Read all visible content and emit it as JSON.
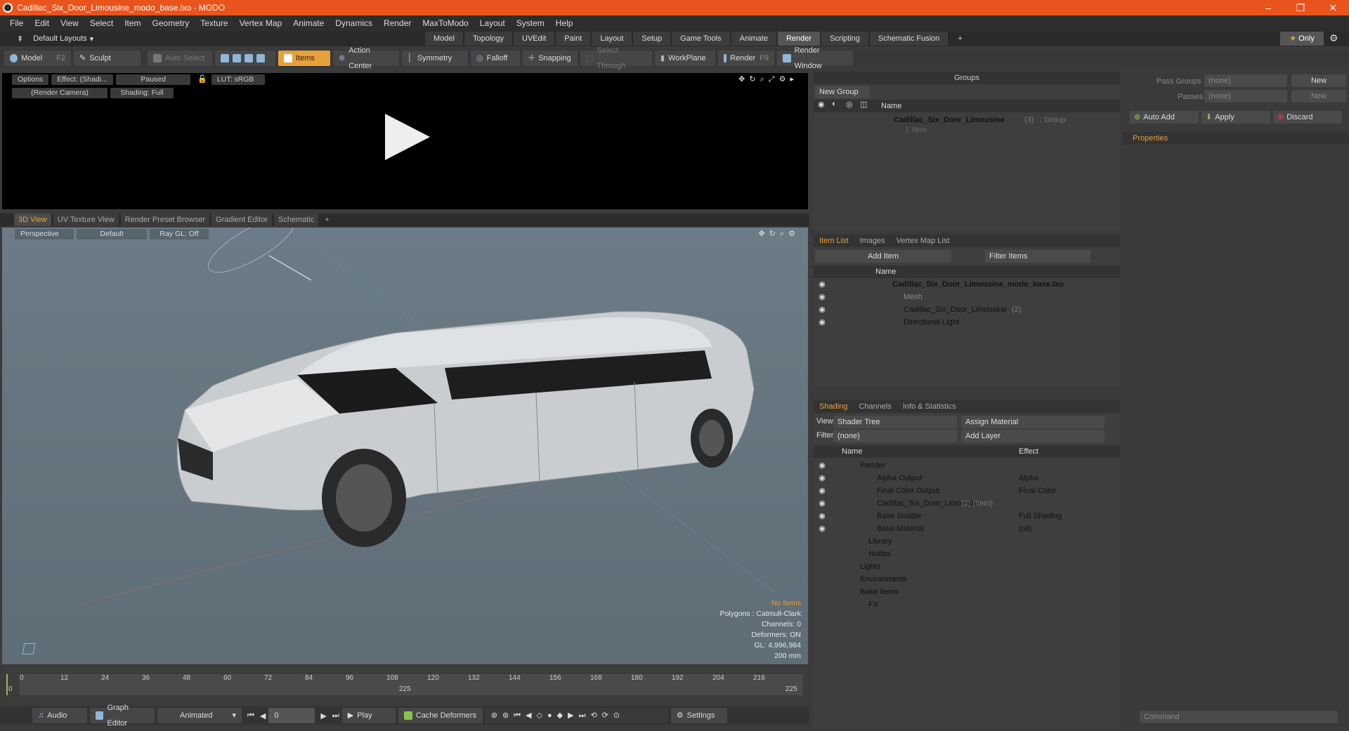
{
  "title": "Cadillac_Six_Door_Limousine_modo_base.lxo - MODO",
  "menu": [
    "File",
    "Edit",
    "View",
    "Select",
    "Item",
    "Geometry",
    "Texture",
    "Vertex Map",
    "Animate",
    "Dynamics",
    "Render",
    "MaxToModo",
    "Layout",
    "System",
    "Help"
  ],
  "layouts": {
    "label": "Default Layouts",
    "tabs": [
      "Model",
      "Topology",
      "UVEdit",
      "Paint",
      "Layout",
      "Setup",
      "Game Tools",
      "Animate",
      "Render",
      "Scripting",
      "Schematic Fusion"
    ],
    "only": "Only"
  },
  "toolbar": {
    "model": "Model",
    "model_key": "F2",
    "sculpt": "Sculpt",
    "auto_select": "Auto Select",
    "items": "Items",
    "action_center": "Action Center",
    "symmetry": "Symmetry",
    "falloff": "Falloff",
    "snapping": "Snapping",
    "select_through": "Select Through",
    "workplane": "WorkPlane",
    "render": "Render",
    "render_key": "F9",
    "render_window": "Render Window"
  },
  "render_view": {
    "options": "Options",
    "effect": "Effect: (Shadi...",
    "paused": "Paused",
    "lut": "LUT: sRGB",
    "camera": "(Render Camera)",
    "shading": "Shading: Full"
  },
  "view_tabs": [
    "3D View",
    "UV Texture View",
    "Render Preset Browser",
    "Gradient Editor",
    "Schematic"
  ],
  "viewport": {
    "mode": "Perspective",
    "style": "Default",
    "raygl": "Ray GL: Off"
  },
  "stats": {
    "no_items": "No Items",
    "polygons": "Polygons : Catmull-Clark",
    "channels": "Channels: 0",
    "deformers": "Deformers: ON",
    "gl": "GL: 4,996,984",
    "scale": "200 mm"
  },
  "timeline": {
    "ticks": [
      "0",
      "12",
      "24",
      "36",
      "48",
      "60",
      "72",
      "84",
      "96",
      "108",
      "120",
      "132",
      "144",
      "156",
      "168",
      "180",
      "192",
      "204",
      "216"
    ],
    "mid": "225",
    "start": "0",
    "end": "225"
  },
  "bottom": {
    "audio": "Audio",
    "graph": "Graph Editor",
    "animated": "Animated",
    "frame": "0",
    "play": "Play",
    "cache": "Cache Deformers",
    "settings": "Settings"
  },
  "groups": {
    "title": "Groups",
    "new_group": "New Group",
    "name_col": "Name",
    "item": "Cadillac_Six_Door_Limousine",
    "count": "(3)",
    "kind": ": Group",
    "sub": "1 Item"
  },
  "item_list": {
    "tabs": [
      "Item List",
      "Images",
      "Vertex Map List"
    ],
    "add_item": "Add Item",
    "filter": "Filter Items",
    "name_col": "Name",
    "scene": "Cadillac_Six_Door_Limousine_modo_base.lxo",
    "mesh": "Mesh",
    "group": "Cadillac_Six_Door_Limousine",
    "group_count": "(2)",
    "light": "Directional Light"
  },
  "shading": {
    "tabs": [
      "Shading",
      "Channels",
      "Info & Statistics"
    ],
    "view_label": "View",
    "view": "Shader Tree",
    "assign": "Assign Material",
    "filter_label": "Filter",
    "filter": "(none)",
    "add_layer": "Add Layer",
    "name_col": "Name",
    "effect_col": "Effect",
    "rows": [
      {
        "name": "Render",
        "effect": ""
      },
      {
        "name": "Alpha Output",
        "effect": "Alpha"
      },
      {
        "name": "Final Color Output",
        "effect": "Final Color"
      },
      {
        "name": "Cadillac_Six_Door_Limousine",
        "extra": "(2) (Item)",
        "effect": ""
      },
      {
        "name": "Base Shader",
        "effect": "Full Shading"
      },
      {
        "name": "Base Material",
        "effect": "(all)"
      },
      {
        "name": "Library",
        "effect": ""
      },
      {
        "name": "Nodes",
        "effect": ""
      },
      {
        "name": "Lights",
        "effect": ""
      },
      {
        "name": "Environments",
        "effect": ""
      },
      {
        "name": "Bake Items",
        "effect": ""
      },
      {
        "name": "FX",
        "effect": ""
      }
    ]
  },
  "passes": {
    "pass_groups": "Pass Groups",
    "passes": "Passes",
    "none": "(none)",
    "new": "New",
    "auto_add": "Auto Add",
    "apply": "Apply",
    "discard": "Discard",
    "properties": "Properties",
    "command": "Command"
  },
  "colors": {
    "title": "#e8541c",
    "accent": "#e8a13a"
  }
}
